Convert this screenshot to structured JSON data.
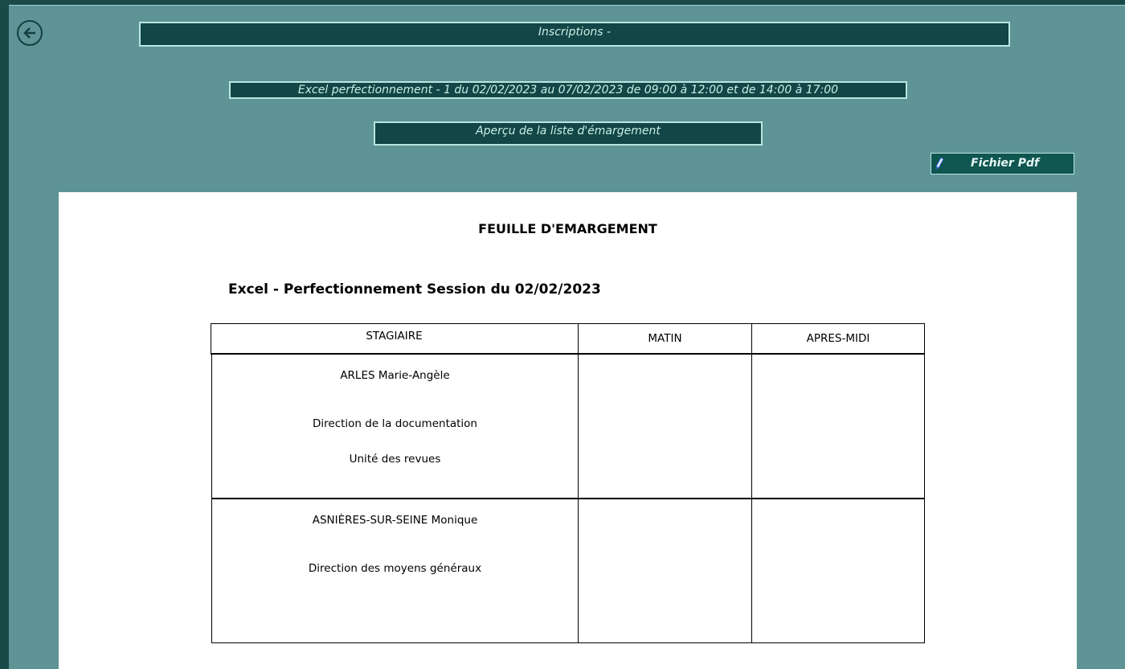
{
  "header": {
    "title": "Inscriptions -",
    "session_label": "Excel perfectionnement - 1 du 02/02/2023 au 07/02/2023 de 09:00 à 12:00 et de 14:00 à 17:00",
    "apercu_label": "Aperçu de la liste d'émargement",
    "pdf_button_label": "Fichier Pdf"
  },
  "sheet": {
    "title": "FEUILLE D'EMARGEMENT",
    "session_title": "Excel - Perfectionnement Session du 02/02/2023",
    "table": {
      "headers": [
        "STAGIAIRE",
        "MATIN",
        "APRES-MIDI"
      ],
      "rows": [
        {
          "name": "ARLES Marie-Angèle",
          "direction": "Direction de la documentation",
          "unit": "Unité des revues"
        },
        {
          "name": "ASNIÈRES-SUR-SEINE Monique",
          "direction": "Direction des moyens généraux",
          "unit": ""
        }
      ]
    }
  },
  "colors": {
    "background": "#5e9496",
    "bar": "#134646",
    "bar_text": "#c8f0e8",
    "sheet": "#ffffff"
  },
  "icons": {
    "back": "arrow-left-circle-icon",
    "pdf": "pencil-icon"
  }
}
